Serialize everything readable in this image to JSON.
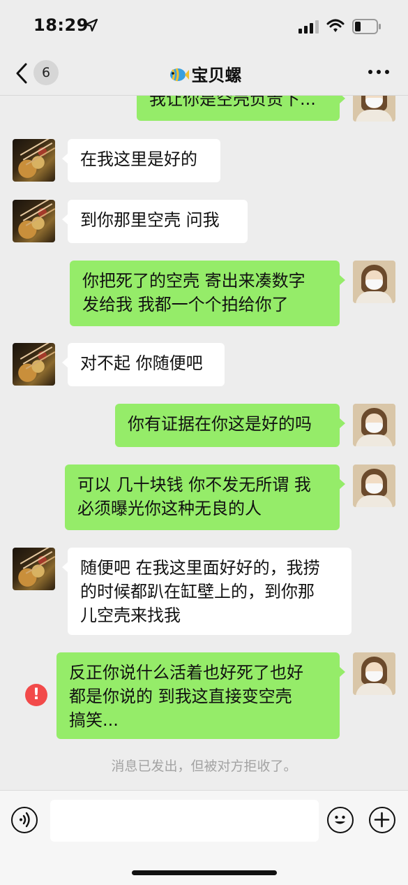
{
  "status_bar": {
    "time": "18:29"
  },
  "nav": {
    "back_badge": "6",
    "title": "宝贝螺",
    "title_icon": "fish-icon"
  },
  "messages": [
    {
      "side": "out",
      "text": "我让你是空壳负责下..."
    },
    {
      "side": "in",
      "text": "在我这里是好的"
    },
    {
      "side": "in",
      "text": "到你那里空壳 问我"
    },
    {
      "side": "out",
      "text": "你把死了的空壳 寄出来凑数字\n发给我 我都一个个拍给你了"
    },
    {
      "side": "in",
      "text": "对不起 你随便吧"
    },
    {
      "side": "out",
      "text": "你有证据在你这是好的吗"
    },
    {
      "side": "out",
      "text": "可以 几十块钱 你不发无所谓 我\n必须曝光你这种无良的人"
    },
    {
      "side": "in",
      "text": "随便吧 在我这里面好好的，我捞\n的时候都趴在缸壁上的，到你那\n儿空壳来找我"
    },
    {
      "side": "out",
      "text": "反正你说什么活着也好死了也好\n都是你说的 到我这直接变空壳\n搞笑...",
      "error": "!"
    }
  ],
  "system_note": "消息已发出，但被对方拒收了。",
  "input": {
    "placeholder": ""
  },
  "colors": {
    "background": "#ededed",
    "outgoing_bubble": "#95ec69",
    "incoming_bubble": "#ffffff",
    "error": "#f24a4a"
  }
}
